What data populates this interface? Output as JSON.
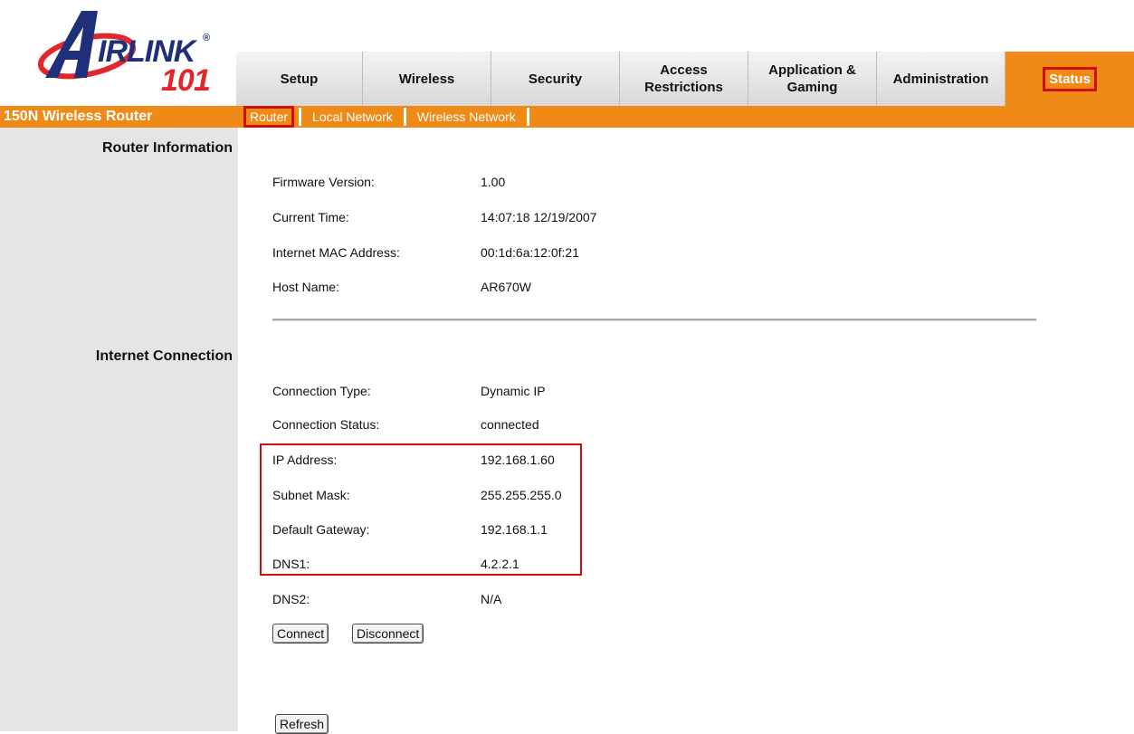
{
  "logo": {
    "brand_text": "IRLINK",
    "number_text": "101",
    "registered": "®",
    "accent_red": "#e3262b",
    "accent_blue": "#1f2f7a"
  },
  "topnav": {
    "tabs": [
      {
        "label": "Setup"
      },
      {
        "label": "Wireless"
      },
      {
        "label": "Security"
      },
      {
        "label": "Access\nRestrictions"
      },
      {
        "label": "Application &\nGaming"
      },
      {
        "label": "Administration"
      },
      {
        "label": "Status",
        "active": true
      }
    ]
  },
  "product_name": "150N Wireless Router",
  "subnav": {
    "items": [
      {
        "label": "Router",
        "active": true
      },
      {
        "label": "Local Network"
      },
      {
        "label": "Wireless Network"
      }
    ]
  },
  "router_info": {
    "title": "Router Information",
    "rows": [
      {
        "label": "Firmware Version:",
        "value": "1.00"
      },
      {
        "label": "Current Time:",
        "value": "14:07:18 12/19/2007"
      },
      {
        "label": "Internet MAC Address:",
        "value": "00:1d:6a:12:0f:21"
      },
      {
        "label": "Host Name:",
        "value": "AR670W"
      }
    ]
  },
  "internet_connection": {
    "title": "Internet Connection",
    "rows": [
      {
        "label": "Connection Type:",
        "value": "Dynamic IP"
      },
      {
        "label": "Connection Status:",
        "value": "connected"
      },
      {
        "label": "IP Address:",
        "value": "192.168.1.60"
      },
      {
        "label": "Subnet Mask:",
        "value": "255.255.255.0"
      },
      {
        "label": "Default Gateway:",
        "value": "192.168.1.1"
      },
      {
        "label": "DNS1:",
        "value": "4.2.2.1"
      },
      {
        "label": "DNS2:",
        "value": "N/A"
      }
    ]
  },
  "buttons": {
    "connect": "Connect",
    "disconnect": "Disconnect",
    "refresh": "Refresh"
  },
  "colors": {
    "orange": "#f08a17",
    "highlight_red": "#d10e0e",
    "left_panel": "#e5e5e5"
  }
}
